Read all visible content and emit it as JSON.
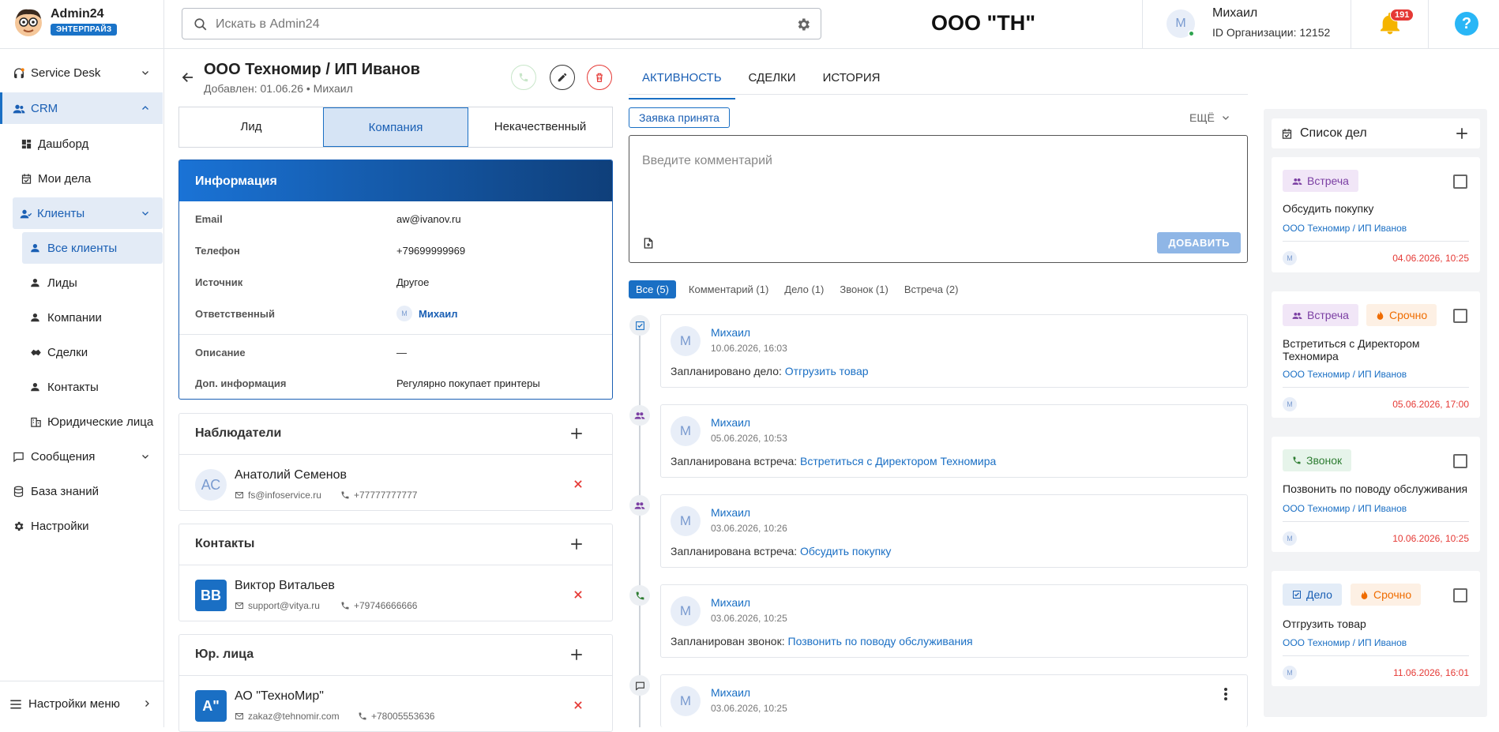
{
  "app": {
    "name": "Admin24",
    "edition": "ЭНТЕРПРАЙЗ"
  },
  "search": {
    "placeholder": "Искать в Admin24"
  },
  "org_name": "ООО \"ТН\"",
  "user": {
    "initial": "М",
    "name": "Михаил",
    "org_id": "ID Организации: 12152"
  },
  "notifications": {
    "count": "191"
  },
  "help_label": "?",
  "sidebar": {
    "items": [
      {
        "label": "Service Desk"
      },
      {
        "label": "CRM"
      },
      {
        "label": "Дашборд"
      },
      {
        "label": "Мои дела"
      },
      {
        "label": "Клиенты"
      },
      {
        "label": "Все клиенты"
      },
      {
        "label": "Лиды"
      },
      {
        "label": "Компании"
      },
      {
        "label": "Сделки"
      },
      {
        "label": "Контакты"
      },
      {
        "label": "Юридические лица"
      },
      {
        "label": "Сообщения"
      },
      {
        "label": "База знаний"
      },
      {
        "label": "Настройки"
      }
    ],
    "bottom": "Настройки меню"
  },
  "client": {
    "title": "ООО Техномир / ИП Иванов",
    "subtitle": "Добавлен: 01.06.26 • Михаил"
  },
  "segments": [
    "Лид",
    "Компания",
    "Некачественный"
  ],
  "info": {
    "title": "Информация",
    "rows": [
      {
        "label": "Email",
        "value": "aw@ivanov.ru"
      },
      {
        "label": "Телефон",
        "value": "+79699999969"
      },
      {
        "label": "Источник",
        "value": "Другое"
      },
      {
        "label": "Ответственный",
        "value": "Михаил"
      },
      {
        "label": "Описание",
        "value": "—"
      },
      {
        "label": "Доп. информация",
        "value": "Регулярно покупает принтеры"
      }
    ],
    "resp_initial": "М"
  },
  "observers": {
    "title": "Наблюдатели",
    "person": {
      "initials": "АС",
      "name": "Анатолий Семенов",
      "email": "fs@infoservice.ru",
      "phone": "+77777777777"
    }
  },
  "contacts": {
    "title": "Контакты",
    "person": {
      "initials": "ВВ",
      "name": "Виктор Витальев",
      "email": "support@vitya.ru",
      "phone": "+79746666666"
    }
  },
  "legal": {
    "title": "Юр. лица",
    "person": {
      "initials": "А\"",
      "name": "АО \"ТехноМир\"",
      "email": "zakaz@tehnomir.com",
      "phone": "+78005553636"
    }
  },
  "tabs": [
    "АКТИВНОСТЬ",
    "СДЕЛКИ",
    "ИСТОРИЯ"
  ],
  "status_chip": "Заявка принята",
  "more_label": "ЕЩЁ",
  "comment": {
    "placeholder": "Введите комментарий",
    "add_label": "ДОБАВИТЬ"
  },
  "filters": [
    "Все (5)",
    "Комментарий (1)",
    "Дело (1)",
    "Звонок (1)",
    "Встреча (2)"
  ],
  "events": [
    {
      "initial": "М",
      "name": "Михаил",
      "date": "10.06.2026, 16:03",
      "prefix": "Запланировано дело: ",
      "link": "Отгрузить товар"
    },
    {
      "initial": "М",
      "name": "Михаил",
      "date": "05.06.2026, 10:53",
      "prefix": "Запланирована встреча: ",
      "link": "Встретиться с Директором Техномира"
    },
    {
      "initial": "М",
      "name": "Михаил",
      "date": "03.06.2026, 10:26",
      "prefix": "Запланирована встреча: ",
      "link": "Обсудить покупку"
    },
    {
      "initial": "М",
      "name": "Михаил",
      "date": "03.06.2026, 10:25",
      "prefix": "Запланирован звонок: ",
      "link": "Позвонить по поводу обслуживания"
    },
    {
      "initial": "М",
      "name": "Михаил",
      "date": "03.06.2026, 10:25",
      "prefix": "",
      "link": ""
    }
  ],
  "todo": {
    "title": "Список дел",
    "items": [
      {
        "tag": "Встреча",
        "urgent": "",
        "desc": "Обсудить покупку",
        "company": "ООО Техномир / ИП Иванов",
        "initial": "М",
        "date": "04.06.2026, 10:25"
      },
      {
        "tag": "Встреча",
        "urgent": "Срочно",
        "desc": "Встретиться с Директором Техномира",
        "company": "ООО Техномир / ИП Иванов",
        "initial": "М",
        "date": "05.06.2026, 17:00"
      },
      {
        "tag": "Звонок",
        "urgent": "",
        "desc": "Позвонить по поводу обслуживания",
        "company": "ООО Техномир / ИП Иванов",
        "initial": "М",
        "date": "10.06.2026, 10:25"
      },
      {
        "tag": "Дело",
        "urgent": "Срочно",
        "desc": "Отгрузить товар",
        "company": "ООО Техномир / ИП Иванов",
        "initial": "М",
        "date": "11.06.2026, 16:01"
      }
    ]
  },
  "colors": {
    "accent": "#1a6fc4",
    "danger": "#e53935",
    "meeting": "#7b3fa3",
    "urgent": "#ef6c00",
    "call": "#2e7d32"
  }
}
